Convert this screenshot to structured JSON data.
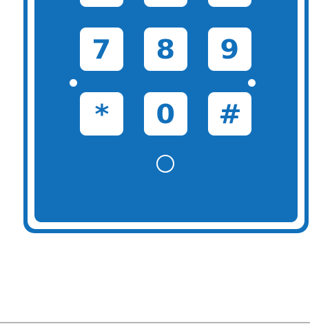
{
  "keypad": {
    "rows": [
      [
        "",
        "",
        ""
      ],
      [
        "7",
        "8",
        "9"
      ],
      [
        "*",
        "0",
        "#"
      ]
    ]
  },
  "colors": {
    "panel_blue": "#1270bb",
    "key_white": "#ffffff"
  }
}
